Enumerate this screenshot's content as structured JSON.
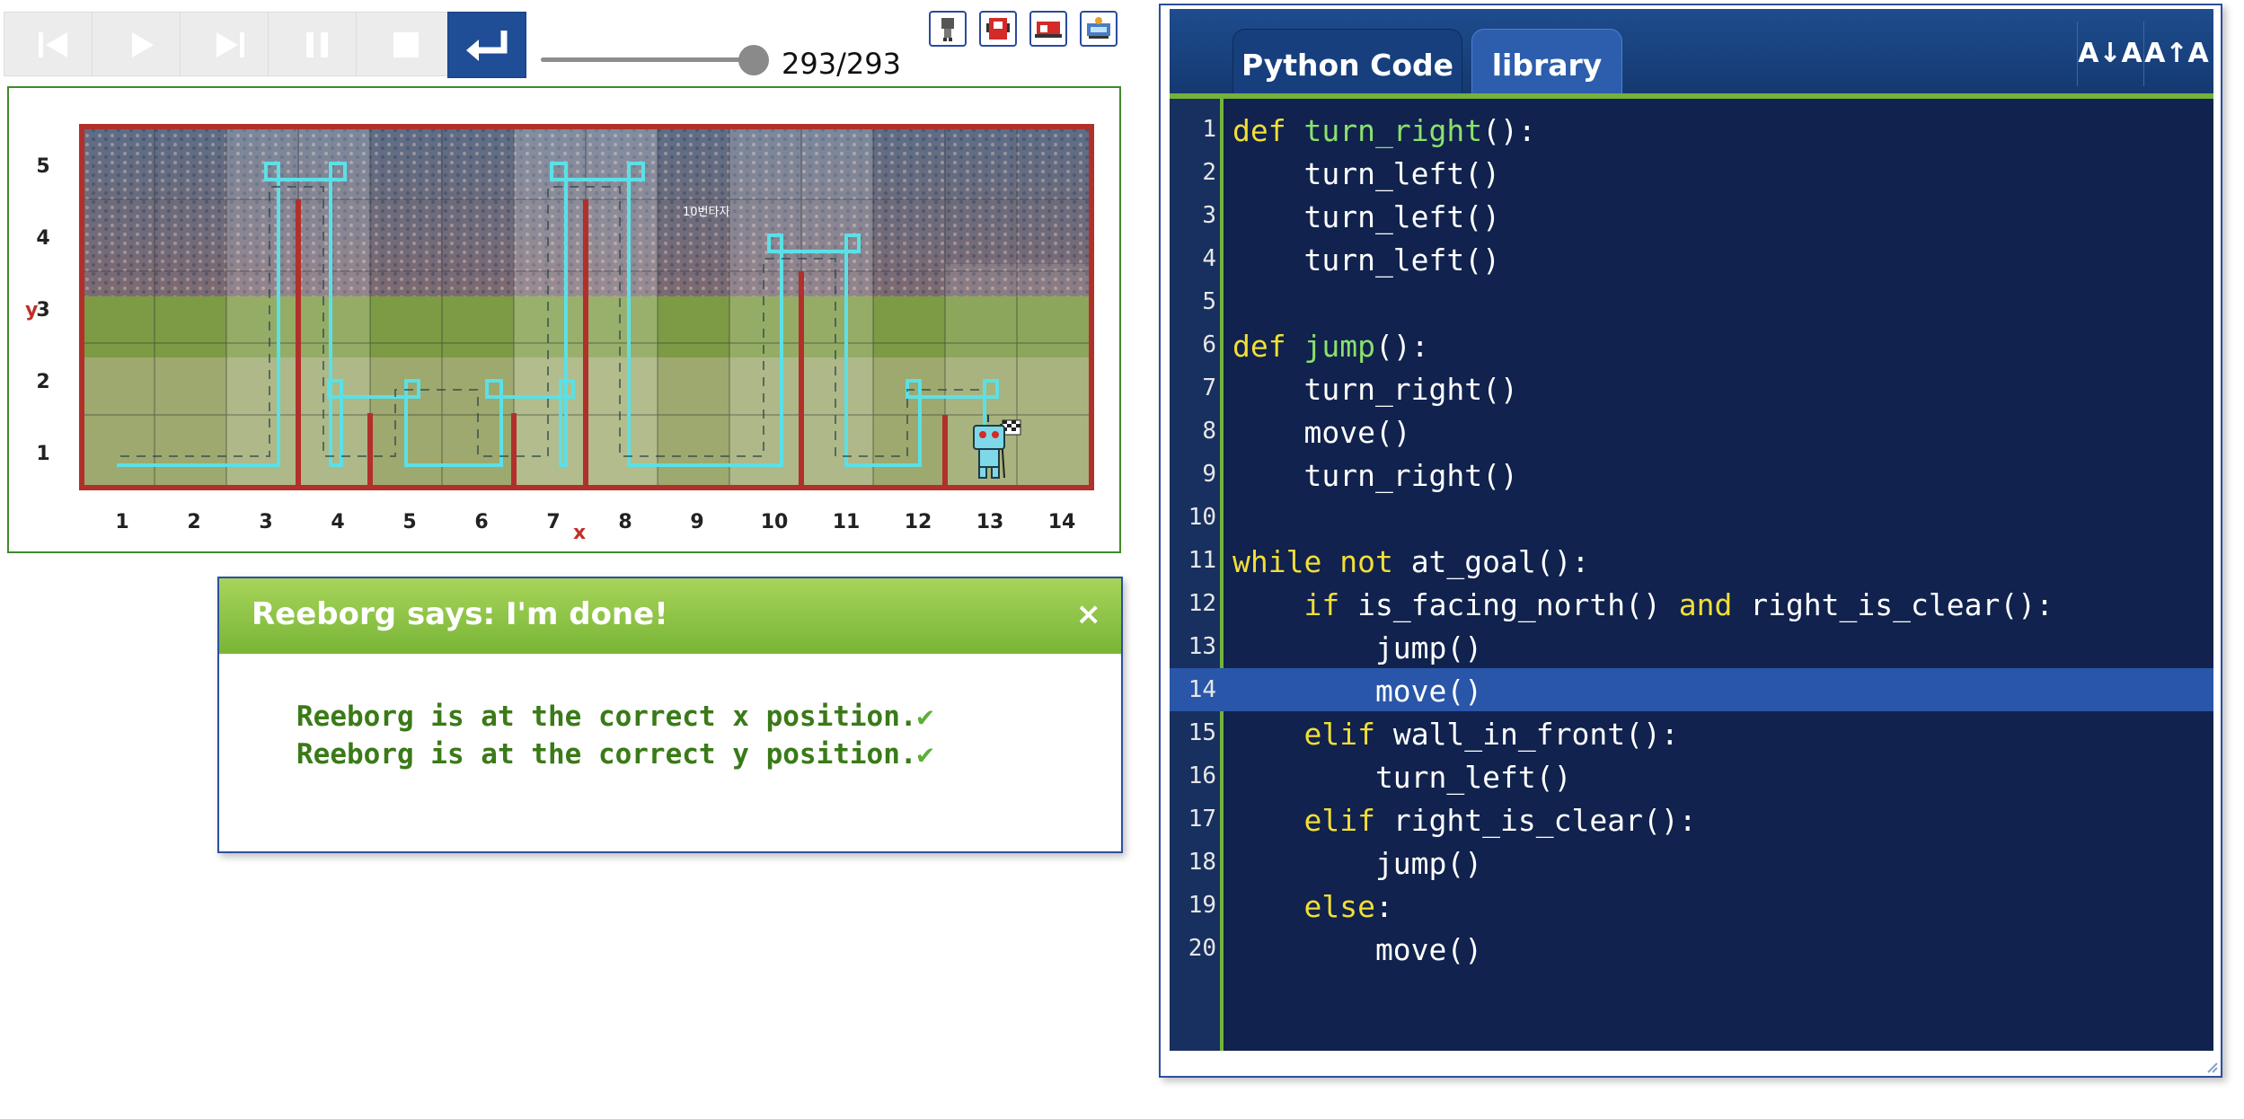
{
  "toolbar": {
    "buttons": [
      "reverse-step",
      "run",
      "step",
      "pause",
      "stop",
      "reload"
    ],
    "step_counter": "293/293",
    "slider_progress": 1.0,
    "icons": [
      "robot-select-icon",
      "highlight-robot-icon",
      "world-info-icon",
      "world-editor-icon"
    ]
  },
  "world": {
    "axis_x_label": "x",
    "axis_y_label": "y",
    "x_ticks": [
      "1",
      "2",
      "3",
      "4",
      "5",
      "6",
      "7",
      "8",
      "9",
      "10",
      "11",
      "12",
      "13",
      "14"
    ],
    "y_ticks": [
      "1",
      "2",
      "3",
      "4",
      "5"
    ],
    "banner_text": "10번타자",
    "colors": {
      "wall": "#b2302a",
      "trace": "#5be0e6",
      "frame": "#3f8a2b"
    }
  },
  "dialog": {
    "title": "Reeborg says: I'm done!",
    "close": "×",
    "lines": [
      "Reeborg is at the correct x position.",
      "Reeborg is at the correct y position."
    ],
    "check": "✔"
  },
  "editor": {
    "tabs": [
      "Python Code",
      "library"
    ],
    "font_decrease": "A↓A",
    "font_increase": "A↑A",
    "active_line": 14,
    "lines": [
      [
        [
          "kw",
          "def "
        ],
        [
          "fn",
          "turn_right"
        ],
        [
          "",
          "():"
        ]
      ],
      [
        [
          "",
          "    turn_left()"
        ]
      ],
      [
        [
          "",
          "    turn_left()"
        ]
      ],
      [
        [
          "",
          "    turn_left()"
        ]
      ],
      [],
      [
        [
          "kw",
          "def "
        ],
        [
          "fn",
          "jump"
        ],
        [
          "",
          "():"
        ]
      ],
      [
        [
          "",
          "    turn_right()"
        ]
      ],
      [
        [
          "",
          "    move()"
        ]
      ],
      [
        [
          "",
          "    turn_right()"
        ]
      ],
      [],
      [
        [
          "kw",
          "while not "
        ],
        [
          "",
          "at_goal():"
        ]
      ],
      [
        [
          "",
          "    "
        ],
        [
          "kw",
          "if "
        ],
        [
          "",
          "is_facing_north() "
        ],
        [
          "kw",
          "and "
        ],
        [
          "",
          "right_is_clear():"
        ]
      ],
      [
        [
          "",
          "        jump()"
        ]
      ],
      [
        [
          "",
          "        move()"
        ]
      ],
      [
        [
          "",
          "    "
        ],
        [
          "kw",
          "elif "
        ],
        [
          "",
          "wall_in_front():"
        ]
      ],
      [
        [
          "",
          "        turn_left()"
        ]
      ],
      [
        [
          "",
          "    "
        ],
        [
          "kw",
          "elif "
        ],
        [
          "",
          "right_is_clear():"
        ]
      ],
      [
        [
          "",
          "        jump()"
        ]
      ],
      [
        [
          "",
          "    "
        ],
        [
          "kw",
          "else"
        ],
        [
          "",
          ":"
        ]
      ],
      [
        [
          "",
          "        move()"
        ]
      ]
    ]
  }
}
